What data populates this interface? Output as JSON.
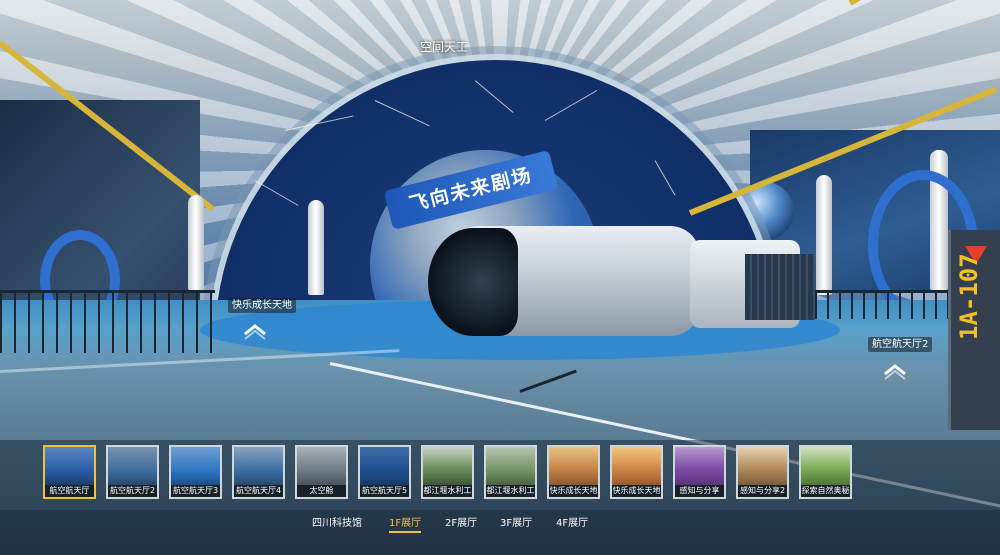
{
  "scene": {
    "title": "空间天工",
    "theater_banner": "飞向未来剧场",
    "sign_code": "1A-107",
    "hotspots": [
      {
        "label": "快乐成长天地"
      },
      {
        "label": "航空航天厅2"
      }
    ]
  },
  "thumbnails": [
    {
      "caption": "航空航天厅",
      "active": true
    },
    {
      "caption": "航空航天厅2"
    },
    {
      "caption": "航空航天厅3"
    },
    {
      "caption": "航空航天厅4"
    },
    {
      "caption": "太空舱"
    },
    {
      "caption": "航空航天厅5"
    },
    {
      "caption": "都江堰水利工"
    },
    {
      "caption": "都江堰水利工"
    },
    {
      "caption": "快乐成长天地"
    },
    {
      "caption": "快乐成长天地"
    },
    {
      "caption": "感知与分享"
    },
    {
      "caption": "感知与分享2"
    },
    {
      "caption": "探索自然奥秘"
    }
  ],
  "tabs": [
    {
      "label": "四川科技馆"
    },
    {
      "label": "1F展厅",
      "active": true
    },
    {
      "label": "2F展厅"
    },
    {
      "label": "3F展厅"
    },
    {
      "label": "4F展厅"
    }
  ],
  "colors": {
    "active_accent": "#f3c24a",
    "floor_blue": "#2e86d0",
    "sign_yellow": "#f2c023"
  }
}
